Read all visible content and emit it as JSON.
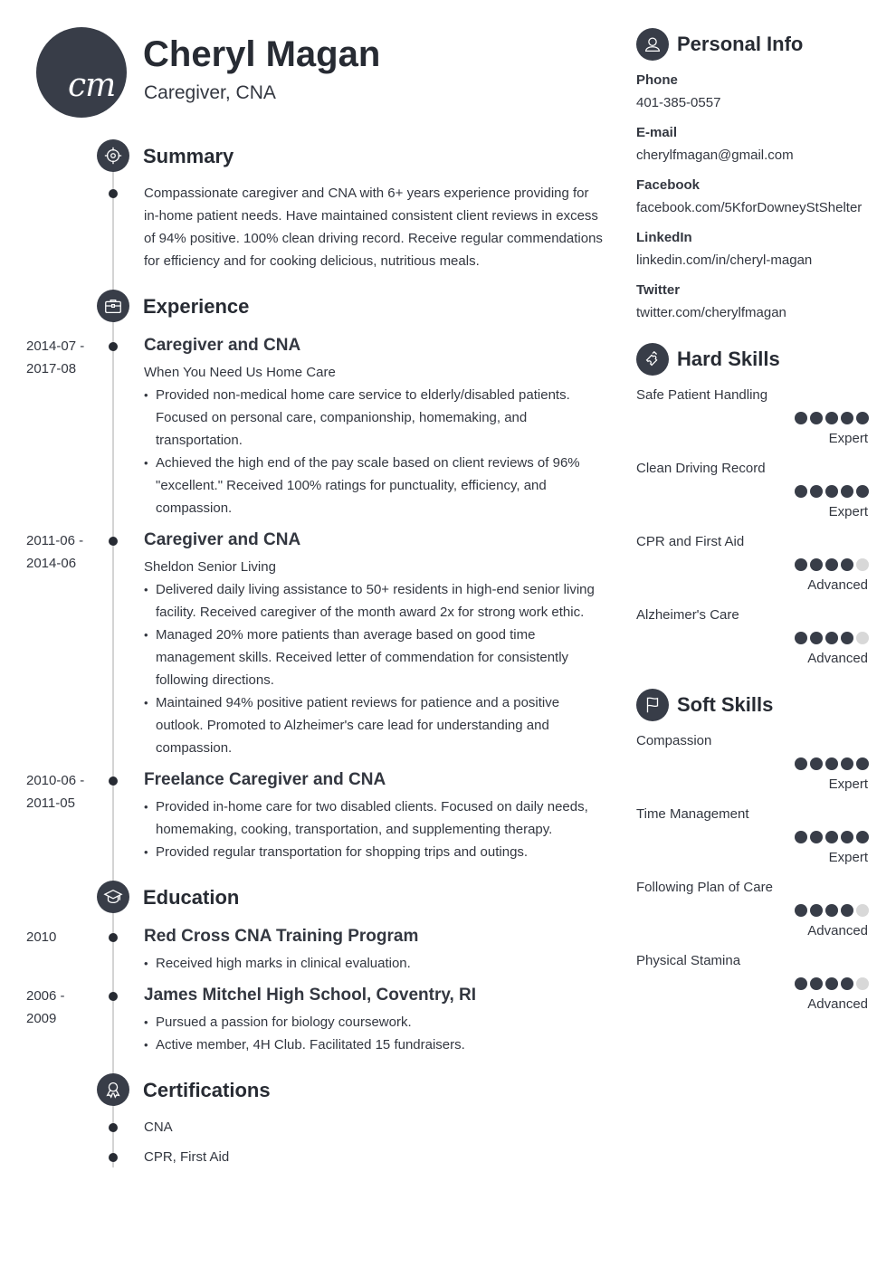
{
  "header": {
    "initials": "cm",
    "name": "Cheryl Magan",
    "title": "Caregiver, CNA"
  },
  "colors": {
    "accent": "#383d48",
    "text": "#333740",
    "timeline": "#d4d4d4",
    "dot_empty": "#d8d8d8"
  },
  "summary": {
    "title": "Summary",
    "icon": "target-icon",
    "text": "Compassionate caregiver and CNA with 6+ years experience providing for in-home patient needs. Have maintained consistent client reviews in excess of 94% positive. 100% clean driving record. Receive regular commendations for efficiency and for cooking delicious, nutritious meals."
  },
  "experience": {
    "title": "Experience",
    "icon": "briefcase-icon",
    "items": [
      {
        "date_start": "2014-07 -",
        "date_end": "2017-08",
        "title": "Caregiver and CNA",
        "employer": "When You Need Us Home Care",
        "bullets": [
          "Provided non-medical home care service to elderly/disabled patients. Focused on personal care, companionship, homemaking, and transportation.",
          "Achieved the high end of the pay scale based on client reviews of 96% \"excellent.\" Received 100% ratings for punctuality, efficiency, and compassion."
        ]
      },
      {
        "date_start": "2011-06 -",
        "date_end": "2014-06",
        "title": "Caregiver and CNA",
        "employer": "Sheldon Senior Living",
        "bullets": [
          "Delivered daily living assistance to 50+ residents in high-end senior living facility. Received caregiver of the month award 2x for strong work ethic.",
          "Managed 20% more patients than average based on good time management skills. Received letter of commendation for consistently following directions.",
          "Maintained 94% positive patient reviews for patience and a positive outlook. Promoted to Alzheimer's care lead for understanding and compassion."
        ]
      },
      {
        "date_start": "2010-06 -",
        "date_end": "2011-05",
        "title": "Freelance Caregiver and CNA",
        "employer": "",
        "bullets": [
          "Provided in-home care for two disabled clients. Focused on daily needs, homemaking, cooking, transportation, and supplementing therapy.",
          "Provided regular transportation for shopping trips and outings."
        ]
      }
    ]
  },
  "education": {
    "title": "Education",
    "icon": "graduation-cap-icon",
    "items": [
      {
        "date_start": "2010",
        "date_end": "",
        "title": "Red Cross CNA Training Program",
        "bullets": [
          "Received high marks in clinical evaluation."
        ]
      },
      {
        "date_start": "2006 -",
        "date_end": "2009",
        "title": "James Mitchel High School, Coventry, RI",
        "bullets": [
          "Pursued a passion for biology coursework.",
          "Active member, 4H Club. Facilitated 15 fundraisers."
        ]
      }
    ]
  },
  "certifications": {
    "title": "Certifications",
    "icon": "award-ribbon-icon",
    "items": [
      "CNA",
      "CPR, First Aid"
    ]
  },
  "personal_info": {
    "title": "Personal Info",
    "icon": "user-icon",
    "fields": [
      {
        "label": "Phone",
        "value": "401-385-0557"
      },
      {
        "label": "E-mail",
        "value": "cherylfmagan@gmail.com"
      },
      {
        "label": "Facebook",
        "value": "facebook.com/5KforDowneyStShelter"
      },
      {
        "label": "LinkedIn",
        "value": "linkedin.com/in/cheryl-magan"
      },
      {
        "label": "Twitter",
        "value": "twitter.com/cherylfmagan"
      }
    ]
  },
  "hard_skills": {
    "title": "Hard Skills",
    "icon": "puzzle-piece-icon",
    "items": [
      {
        "name": "Safe Patient Handling",
        "rating": 5,
        "max": 5,
        "level": "Expert"
      },
      {
        "name": "Clean Driving Record",
        "rating": 5,
        "max": 5,
        "level": "Expert"
      },
      {
        "name": "CPR and First Aid",
        "rating": 4,
        "max": 5,
        "level": "Advanced"
      },
      {
        "name": "Alzheimer's Care",
        "rating": 4,
        "max": 5,
        "level": "Advanced"
      }
    ]
  },
  "soft_skills": {
    "title": "Soft Skills",
    "icon": "flag-icon",
    "items": [
      {
        "name": "Compassion",
        "rating": 5,
        "max": 5,
        "level": "Expert"
      },
      {
        "name": "Time Management",
        "rating": 5,
        "max": 5,
        "level": "Expert"
      },
      {
        "name": "Following Plan of Care",
        "rating": 4,
        "max": 5,
        "level": "Advanced"
      },
      {
        "name": "Physical Stamina",
        "rating": 4,
        "max": 5,
        "level": "Advanced"
      }
    ]
  }
}
